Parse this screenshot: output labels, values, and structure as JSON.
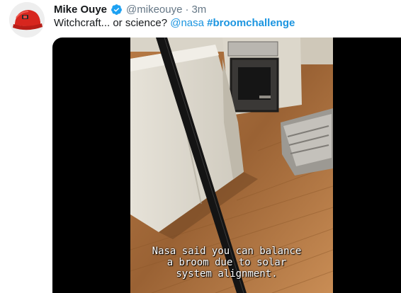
{
  "tweet": {
    "author_name": "Mike Ouye",
    "author_handle": "@mikeouye",
    "separator": "·",
    "time_ago": "3m",
    "text_prefix": "Witchcraft... or science? ",
    "mention": "@nasa",
    "hashtag": "#broomchallenge",
    "verified": true,
    "accent_color": "#1b95e0"
  },
  "media": {
    "type": "video",
    "caption_lines": [
      "Nasa said you can balance",
      "a broom due to solar",
      "system alignment."
    ]
  },
  "icons": {
    "avatar": "red-baseball-cap-avatar",
    "verified": "verified-badge-icon"
  }
}
